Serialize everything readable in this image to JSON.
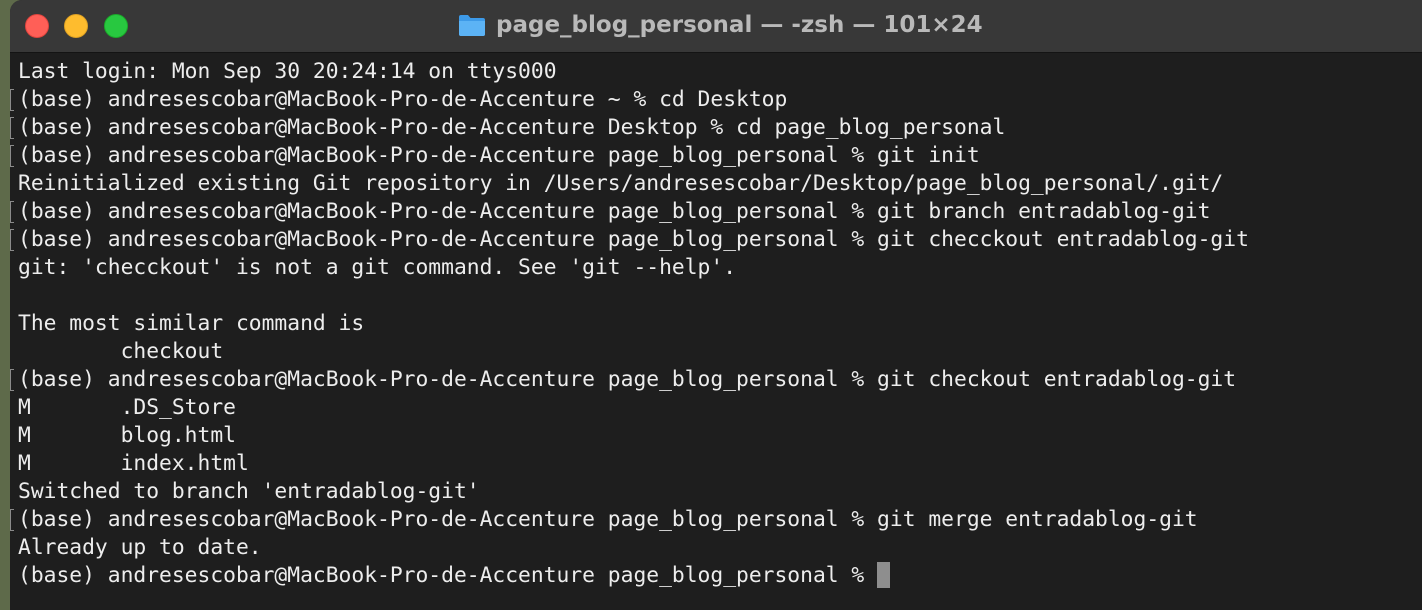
{
  "window": {
    "title": "page_blog_personal — -zsh — 101×24"
  },
  "icons": {
    "title_icon": "folder-icon",
    "close": "close-button",
    "minimize": "minimize-button",
    "zoom": "zoom-button"
  },
  "colors": {
    "close": "#ff5f57",
    "minimize": "#febc2e",
    "zoom": "#28c840",
    "terminal_bg": "#1e1e1e",
    "terminal_fg": "#ededed",
    "cursor": "#8e8e8e"
  },
  "terminal": {
    "lines": [
      {
        "text": "Last login: Mon Sep 30 20:24:14 on ttys000",
        "mark": false
      },
      {
        "text": "(base) andresescobar@MacBook-Pro-de-Accenture ~ % cd Desktop",
        "mark": true
      },
      {
        "text": "(base) andresescobar@MacBook-Pro-de-Accenture Desktop % cd page_blog_personal",
        "mark": true
      },
      {
        "text": "(base) andresescobar@MacBook-Pro-de-Accenture page_blog_personal % git init",
        "mark": true
      },
      {
        "text": "Reinitialized existing Git repository in /Users/andresescobar/Desktop/page_blog_personal/.git/",
        "mark": false
      },
      {
        "text": "(base) andresescobar@MacBook-Pro-de-Accenture page_blog_personal % git branch entradablog-git",
        "mark": true
      },
      {
        "text": "(base) andresescobar@MacBook-Pro-de-Accenture page_blog_personal % git checckout entradablog-git",
        "mark": true
      },
      {
        "text": "git: 'checckout' is not a git command. See 'git --help'.",
        "mark": false
      },
      {
        "text": "",
        "mark": false
      },
      {
        "text": "The most similar command is",
        "mark": false
      },
      {
        "text": "        checkout",
        "mark": false
      },
      {
        "text": "(base) andresescobar@MacBook-Pro-de-Accenture page_blog_personal % git checkout entradablog-git",
        "mark": true
      },
      {
        "text": "M       .DS_Store",
        "mark": false
      },
      {
        "text": "M       blog.html",
        "mark": false
      },
      {
        "text": "M       index.html",
        "mark": false
      },
      {
        "text": "Switched to branch 'entradablog-git'",
        "mark": false
      },
      {
        "text": "(base) andresescobar@MacBook-Pro-de-Accenture page_blog_personal % git merge entradablog-git",
        "mark": true
      },
      {
        "text": "Already up to date.",
        "mark": false
      }
    ],
    "prompt": "(base) andresescobar@MacBook-Pro-de-Accenture page_blog_personal % "
  }
}
